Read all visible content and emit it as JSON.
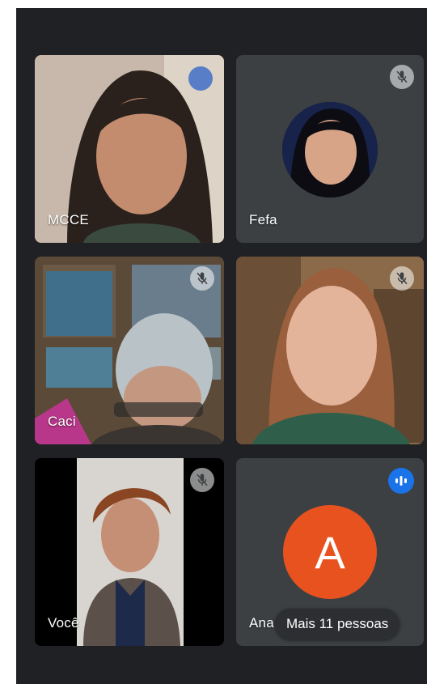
{
  "participants": [
    {
      "name": "MCCE",
      "muted": false,
      "indicator": "blue-dot"
    },
    {
      "name": "Fefa",
      "muted": true
    },
    {
      "name": "Caci",
      "muted": true
    },
    {
      "name": "",
      "muted": true
    },
    {
      "name": "Você",
      "muted": true
    },
    {
      "name": "Ana",
      "muted": false,
      "avatar_letter": "A",
      "speaking": true
    }
  ],
  "more_people_label": "Mais 11 pessoas",
  "colors": {
    "background": "#202124",
    "tile": "#3c4043",
    "avatar": "#e8521e",
    "speaking": "#1a73e8"
  },
  "icons": {
    "muted": "mic-off-icon",
    "speaking": "audio-wave-icon"
  }
}
